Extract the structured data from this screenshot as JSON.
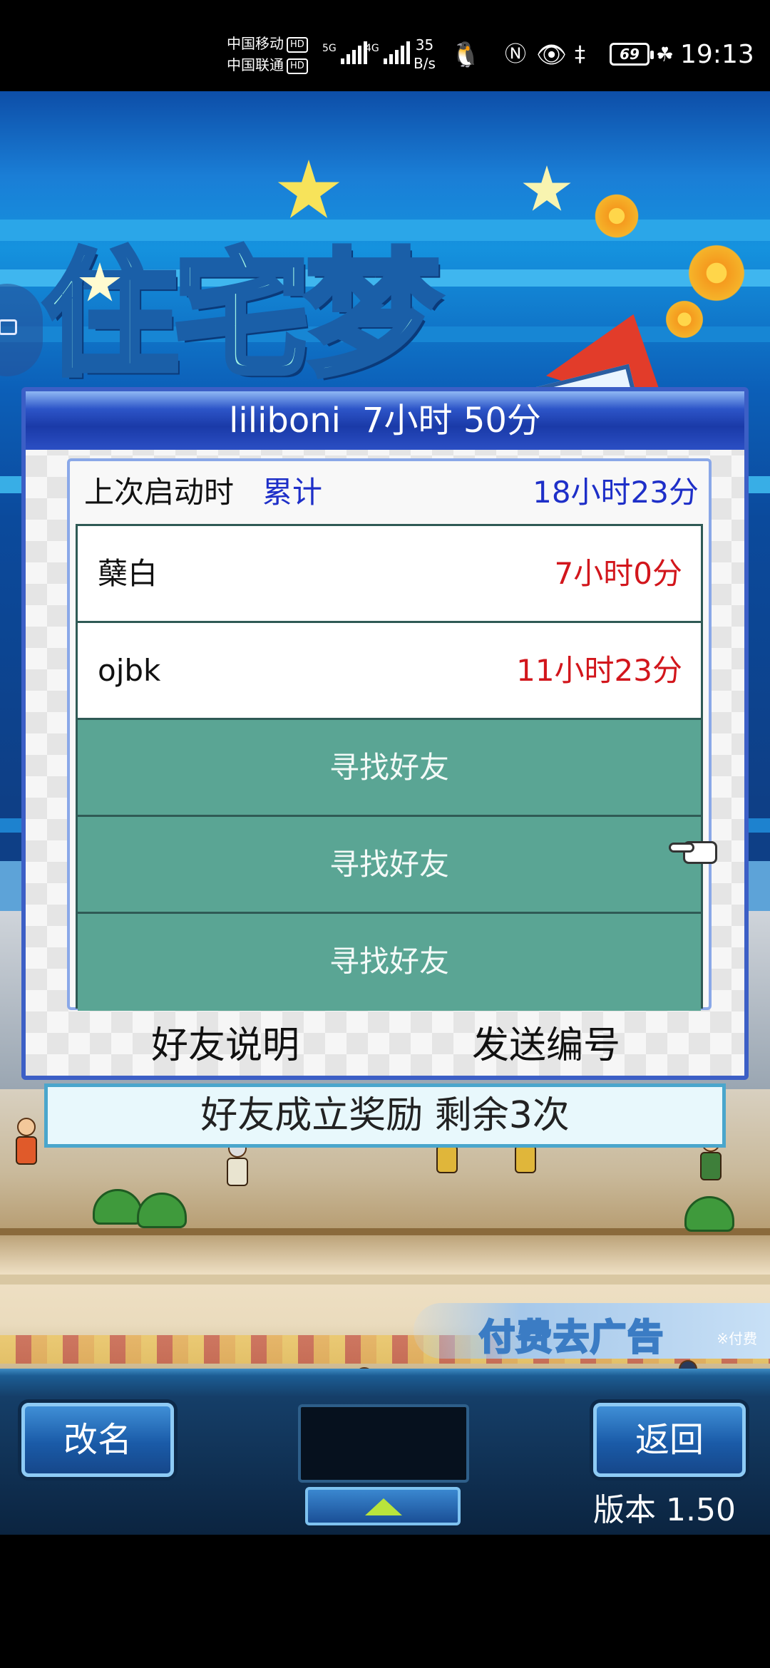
{
  "status_bar": {
    "carrier1": "中国移动",
    "carrier2": "中国联通",
    "hd": "HD",
    "net1": "5G",
    "net2": "4G",
    "speed_value": "35",
    "speed_unit": "B/s",
    "battery": "69",
    "time": "19:13"
  },
  "dialog": {
    "title_name": "liliboni",
    "title_time": "7小时 50分",
    "summary_label": "上次启动时",
    "summary_mid": "累计",
    "summary_total": "18小时23分",
    "friends": [
      {
        "name": "蘖白",
        "time": "7小时0分"
      },
      {
        "name": "ojbk",
        "time": "11小时23分"
      }
    ],
    "find_friend_label": "寻找好友",
    "friend_help_button": "好友说明",
    "send_id_button": "发送编号"
  },
  "reward_banner": "好友成立奖励  剩余3次",
  "ad_banner": {
    "title": "付费去广告",
    "sub": "※付费"
  },
  "toolbar": {
    "rename_button": "改名",
    "back_button": "返回",
    "version": "版本 1.50"
  }
}
